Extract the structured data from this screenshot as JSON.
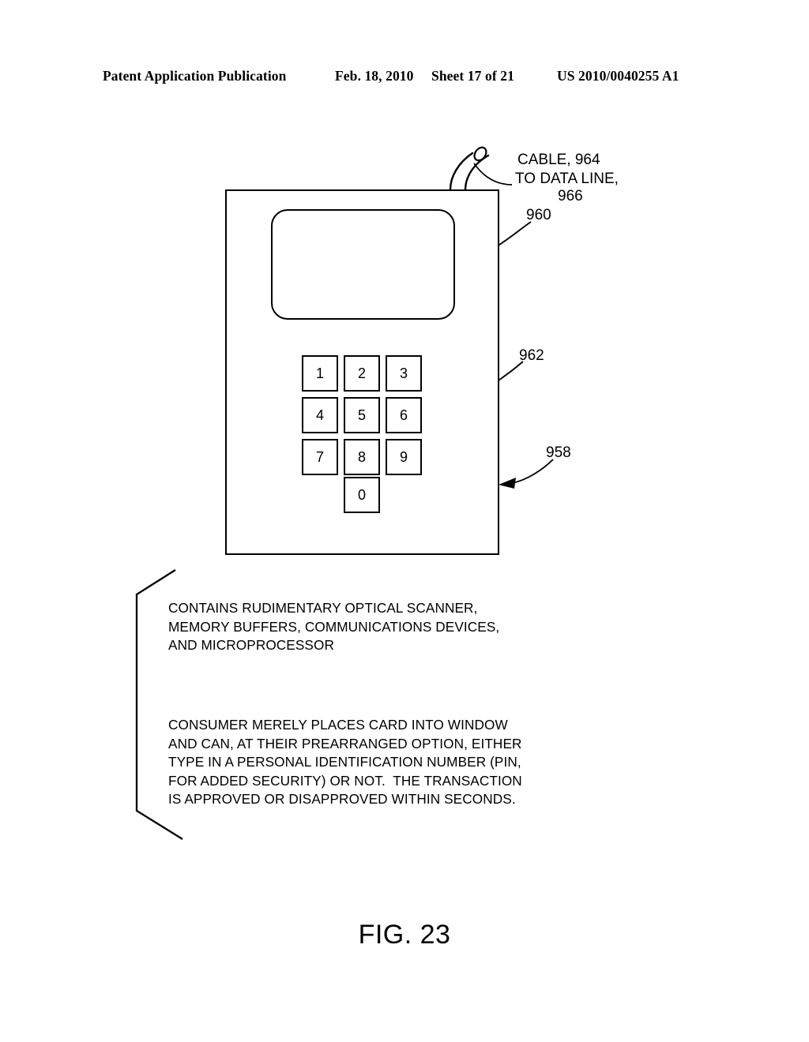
{
  "header": {
    "publication": "Patent Application Publication",
    "date": "Feb. 18, 2010",
    "sheet": "Sheet 17 of 21",
    "patent_number": "US 2010/0040255 A1"
  },
  "figure": {
    "caption": "FIG. 23",
    "labels": {
      "cable": "CABLE, 964",
      "data_line": "TO DATA LINE,",
      "data_line_number": "966",
      "display_window": "960",
      "keypad": "962",
      "device_body": "958"
    },
    "keypad": {
      "rows": [
        [
          "1",
          "2",
          "3"
        ],
        [
          "4",
          "5",
          "6"
        ],
        [
          "7",
          "8",
          "9"
        ]
      ],
      "zero": "0"
    },
    "annotations": {
      "components": "CONTAINS RUDIMENTARY OPTICAL SCANNER,\nMEMORY BUFFERS, COMMUNICATIONS DEVICES,\nAND MICROPROCESSOR",
      "operation": "CONSUMER MERELY PLACES CARD INTO WINDOW\nAND CAN, AT THEIR PREARRANGED OPTION, EITHER\nTYPE IN A PERSONAL IDENTIFICATION NUMBER (PIN,\nFOR ADDED SECURITY) OR NOT.  THE TRANSACTION\nIS APPROVED OR DISAPPROVED WITHIN SECONDS."
    },
    "colors": {
      "ink": "#000000",
      "paper": "#ffffff"
    }
  }
}
